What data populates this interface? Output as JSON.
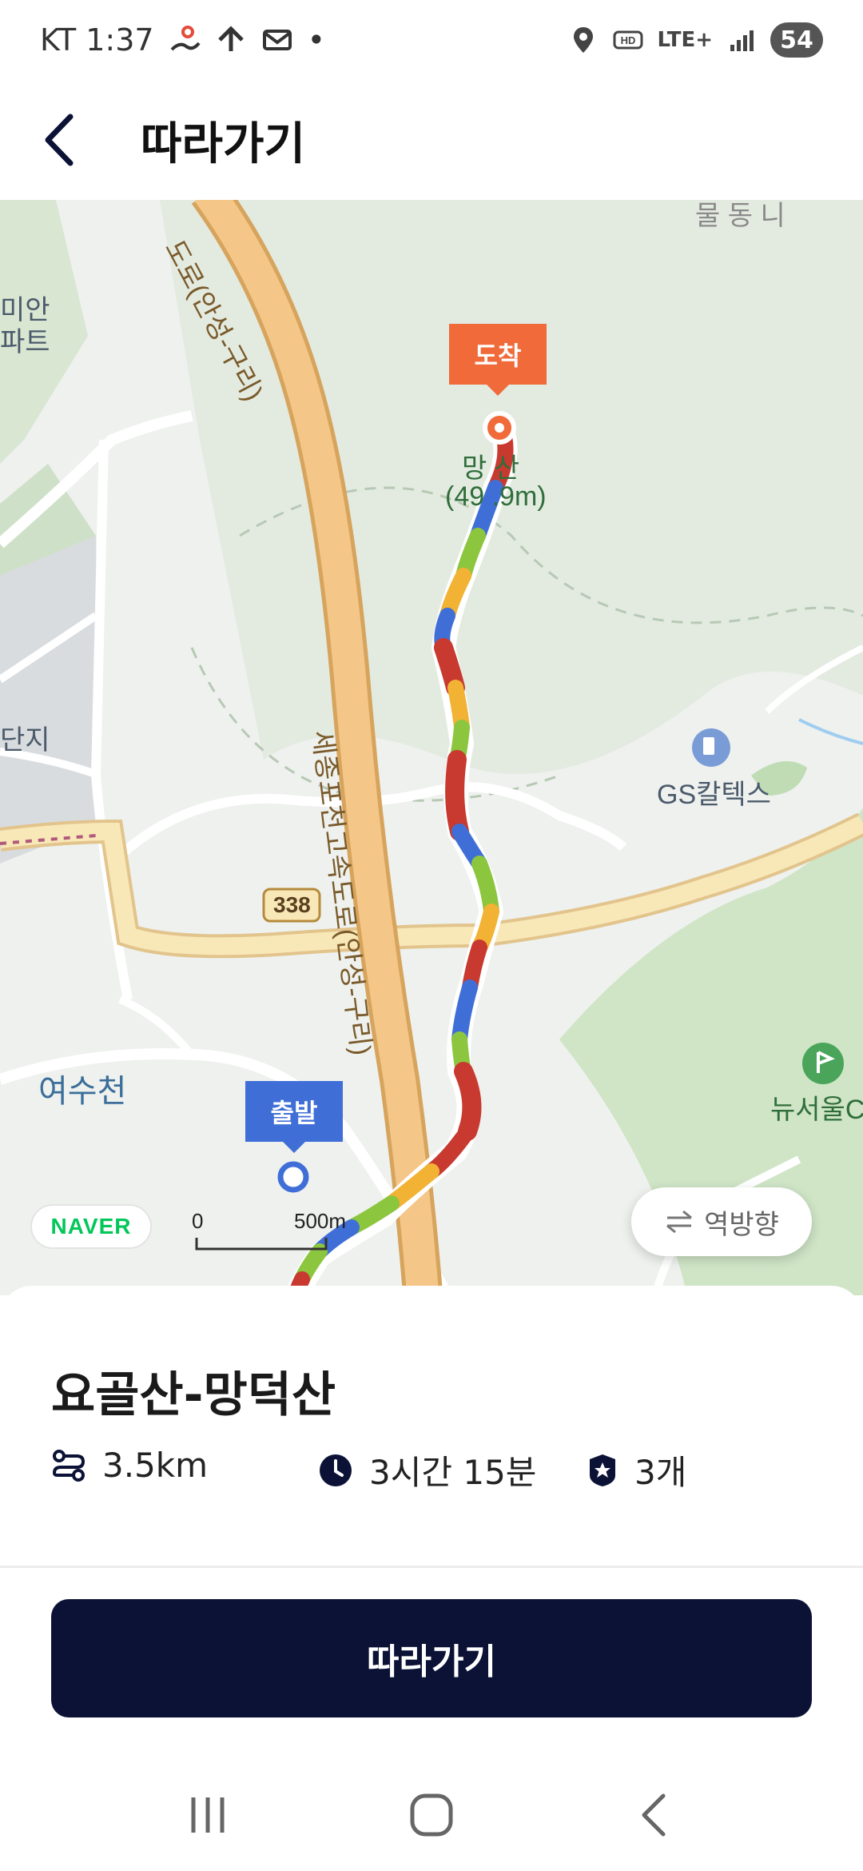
{
  "status_bar": {
    "carrier_time": "KT 1:37",
    "dot": "•",
    "network": "LTE+",
    "battery": "54",
    "icons": [
      "hiking-icon",
      "navigation-icon",
      "mail-icon",
      "location-icon",
      "hd-icon",
      "signal-icon"
    ]
  },
  "header": {
    "title": "따라가기",
    "back_icon": "chevron-left-icon"
  },
  "map": {
    "start_label": "출발",
    "end_label": "도착",
    "road_name": "세종포천고속도로(안성-구리)",
    "road_name_top": "도로(안성-구리)",
    "route_number": "338",
    "peak_name": "망덕산",
    "peak_height": "(499.9m)",
    "peak_name_visible": "망   산",
    "peak_height_visible": "(49  .9m)",
    "gas_station": "GS칼텍스",
    "stream": "여수천",
    "golf": "뉴서울C",
    "edge_label_1": "단지",
    "edge_label_2a": "미안",
    "edge_label_2b": "파트",
    "top_partial": "물 동 니",
    "brand": "NAVER",
    "scale_zero": "0",
    "scale_distance": "500m",
    "reverse_label": "역방향",
    "colors": {
      "route_red": "#c8392f",
      "route_green": "#8cc63f",
      "route_blue": "#3f6fd6",
      "route_yellow": "#f2b233",
      "road_orange": "#f0c27b",
      "forest": "#cfe5c6"
    }
  },
  "course": {
    "title": "요골산-망덕산",
    "distance": "3.5km",
    "duration": "3시간 15분",
    "stamps": "3개"
  },
  "cta": {
    "label": "따라가기"
  },
  "nav": {
    "recent": "recent-apps-icon",
    "home": "home-icon",
    "back": "back-icon"
  }
}
